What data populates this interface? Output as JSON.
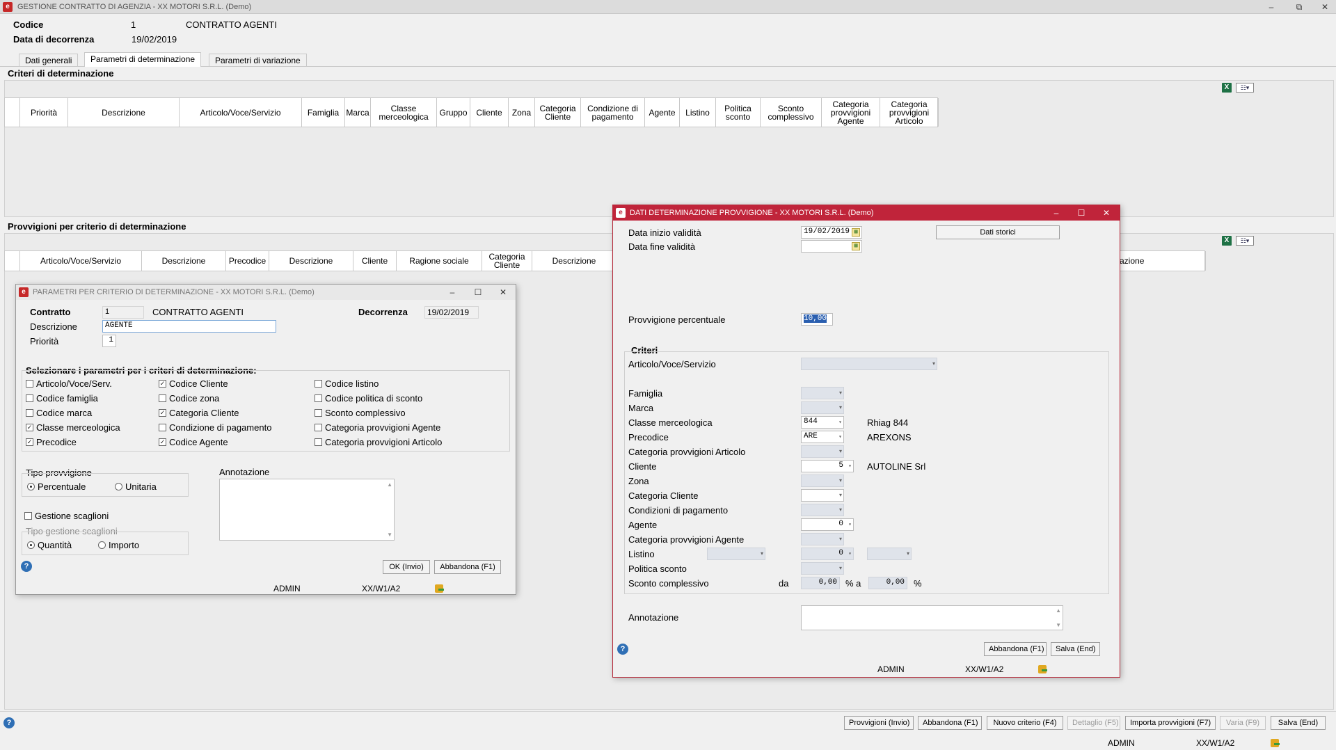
{
  "window": {
    "title": "GESTIONE CONTRATTO DI AGENZIA - XX  MOTORI S.R.L.  (Demo)",
    "minimize": "–",
    "restore": "⧉",
    "close": "✕"
  },
  "header": {
    "codice_label": "Codice",
    "codice_value": "1",
    "contract_name": "CONTRATTO AGENTI",
    "data_label": "Data di decorrenza",
    "data_value": "19/02/2019"
  },
  "tabs": [
    {
      "label": "Dati generali"
    },
    {
      "label": "Parametri di determinazione"
    },
    {
      "label": "Parametri di variazione"
    }
  ],
  "criteri": {
    "title": "Criteri di determinazione",
    "columns": [
      "Priorità",
      "Descrizione",
      "Articolo/Voce/Servizio",
      "Famiglia",
      "Marca",
      "Classe merceologica",
      "Gruppo",
      "Cliente",
      "Zona",
      "Categoria Cliente",
      "Condizione di pagamento",
      "Agente",
      "Listino",
      "Politica sconto",
      "Sconto complessivo",
      "Categoria provvigioni Agente",
      "Categoria provvigioni Articolo"
    ]
  },
  "provvigioni": {
    "title": "Provvigioni per criterio di determinazione",
    "columns": [
      "Articolo/Voce/Servizio",
      "Descrizione",
      "Precodice",
      "Descrizione",
      "Cliente",
      "Ragione sociale",
      "Categoria Cliente",
      "Descrizione"
    ],
    "last_column": "zazione"
  },
  "toolbar_icons": {
    "excel": "X",
    "grid": "☷▾"
  },
  "bottom_bar": {
    "buttons": [
      {
        "label": "Provvigioni (Invio)",
        "disabled": false
      },
      {
        "label": "Abbandona (F1)",
        "disabled": false
      },
      {
        "label": "Nuovo criterio (F4)",
        "disabled": false
      },
      {
        "label": "Dettaglio (F5)",
        "disabled": true
      },
      {
        "label": "Importa provvigioni (F7)",
        "disabled": false
      },
      {
        "label": "Varia (F9)",
        "disabled": true
      },
      {
        "label": "Salva (End)",
        "disabled": false
      }
    ],
    "user": "ADMIN",
    "terminal": "XX/W1/A2"
  },
  "dialog_params": {
    "title": "PARAMETRI PER CRITERIO DI DETERMINAZIONE - XX  MOTORI S.R.L.  (Demo)",
    "contratto_label": "Contratto",
    "contratto_value": "1",
    "contratto_name": "CONTRATTO AGENTI",
    "decorrenza_label": "Decorrenza",
    "decorrenza_value": "19/02/2019",
    "descrizione_label": "Descrizione",
    "descrizione_value": "AGENTE",
    "priorita_label": "Priorità",
    "priorita_value": "1",
    "select_title": "Selezionare i parametri per i criteri di determinazione:",
    "checkboxes": [
      {
        "label": "Articolo/Voce/Serv.",
        "checked": false
      },
      {
        "label": "Codice famiglia",
        "checked": false
      },
      {
        "label": "Codice marca",
        "checked": false
      },
      {
        "label": "Classe merceologica",
        "checked": true
      },
      {
        "label": "Precodice",
        "checked": true
      },
      {
        "label": "Codice Cliente",
        "checked": true
      },
      {
        "label": "Codice zona",
        "checked": false
      },
      {
        "label": "Categoria Cliente",
        "checked": true
      },
      {
        "label": "Condizione di pagamento",
        "checked": false
      },
      {
        "label": "Codice Agente",
        "checked": true
      },
      {
        "label": "Codice listino",
        "checked": false
      },
      {
        "label": "Codice politica di sconto",
        "checked": false
      },
      {
        "label": "Sconto complessivo",
        "checked": false
      },
      {
        "label": "Categoria provvigioni Agente",
        "checked": false
      },
      {
        "label": "Categoria provvigioni Articolo",
        "checked": false
      }
    ],
    "tipo_provvigione_label": "Tipo provvigione",
    "tipo_percentuale": "Percentuale",
    "tipo_unitaria": "Unitaria",
    "annotazione_label": "Annotazione",
    "gestione_scaglioni": "Gestione scaglioni",
    "tipo_gestione_label": "Tipo gestione scaglioni",
    "tipo_quantita": "Quantità",
    "tipo_importo": "Importo",
    "ok_button": "OK (Invio)",
    "abbandona_button": "Abbandona (F1)",
    "user": "ADMIN",
    "terminal": "XX/W1/A2",
    "help": "?"
  },
  "dialog_dati": {
    "title": "DATI DETERMINAZIONE PROVVIGIONE - XX  MOTORI S.R.L.  (Demo)",
    "inizio_label": "Data inizio validità",
    "inizio_value": "19/02/2019",
    "fine_label": "Data fine validità",
    "fine_value": "",
    "storici_button": "Dati storici",
    "percentuale_label": "Provvigione percentuale",
    "percentuale_value": "10,00",
    "criteri_title": "Criteri",
    "fields": {
      "articolo": "Articolo/Voce/Servizio",
      "famiglia": "Famiglia",
      "marca": "Marca",
      "classe": "Classe merceologica",
      "classe_value": "844",
      "classe_desc": "Rhiag 844",
      "precodice": "Precodice",
      "precodice_value": "ARE",
      "precodice_desc": "AREXONS",
      "cat_art": "Categoria provvigioni Articolo",
      "cliente": "Cliente",
      "cliente_value": "5",
      "cliente_desc": "AUTOLINE Srl",
      "zona": "Zona",
      "cat_cliente": "Categoria Cliente",
      "condizioni": "Condizioni di pagamento",
      "agente": "Agente",
      "agente_value": "0",
      "cat_agente": "Categoria provvigioni Agente",
      "listino": "Listino",
      "listino_value": "0",
      "politica": "Politica sconto",
      "sconto": "Sconto complessivo",
      "da": "da",
      "sconto_da": "0,00",
      "pct_a": "% a",
      "sconto_a": "0,00",
      "pct": "%"
    },
    "annotazione_label": "Annotazione",
    "abbandona_button": "Abbandona (F1)",
    "salva_button": "Salva (End)",
    "user": "ADMIN",
    "terminal": "XX/W1/A2",
    "help": "?"
  },
  "colors": {
    "accent_red": "#c0243a",
    "help_blue": "#2f6fb5"
  }
}
